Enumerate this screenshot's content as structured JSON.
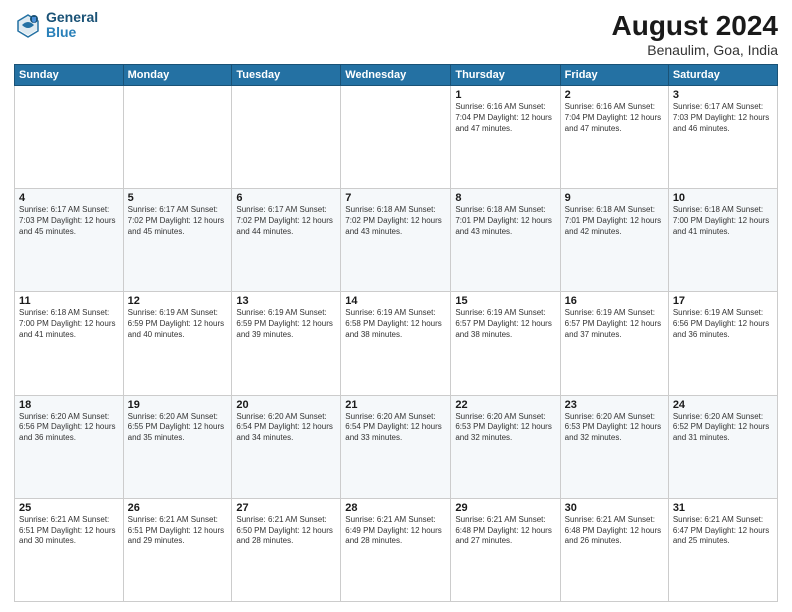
{
  "header": {
    "logo_line1": "General",
    "logo_line2": "Blue",
    "title": "August 2024",
    "subtitle": "Benaulim, Goa, India"
  },
  "weekdays": [
    "Sunday",
    "Monday",
    "Tuesday",
    "Wednesday",
    "Thursday",
    "Friday",
    "Saturday"
  ],
  "weeks": [
    [
      {
        "day": "",
        "content": ""
      },
      {
        "day": "",
        "content": ""
      },
      {
        "day": "",
        "content": ""
      },
      {
        "day": "",
        "content": ""
      },
      {
        "day": "1",
        "content": "Sunrise: 6:16 AM\nSunset: 7:04 PM\nDaylight: 12 hours\nand 47 minutes."
      },
      {
        "day": "2",
        "content": "Sunrise: 6:16 AM\nSunset: 7:04 PM\nDaylight: 12 hours\nand 47 minutes."
      },
      {
        "day": "3",
        "content": "Sunrise: 6:17 AM\nSunset: 7:03 PM\nDaylight: 12 hours\nand 46 minutes."
      }
    ],
    [
      {
        "day": "4",
        "content": "Sunrise: 6:17 AM\nSunset: 7:03 PM\nDaylight: 12 hours\nand 45 minutes."
      },
      {
        "day": "5",
        "content": "Sunrise: 6:17 AM\nSunset: 7:02 PM\nDaylight: 12 hours\nand 45 minutes."
      },
      {
        "day": "6",
        "content": "Sunrise: 6:17 AM\nSunset: 7:02 PM\nDaylight: 12 hours\nand 44 minutes."
      },
      {
        "day": "7",
        "content": "Sunrise: 6:18 AM\nSunset: 7:02 PM\nDaylight: 12 hours\nand 43 minutes."
      },
      {
        "day": "8",
        "content": "Sunrise: 6:18 AM\nSunset: 7:01 PM\nDaylight: 12 hours\nand 43 minutes."
      },
      {
        "day": "9",
        "content": "Sunrise: 6:18 AM\nSunset: 7:01 PM\nDaylight: 12 hours\nand 42 minutes."
      },
      {
        "day": "10",
        "content": "Sunrise: 6:18 AM\nSunset: 7:00 PM\nDaylight: 12 hours\nand 41 minutes."
      }
    ],
    [
      {
        "day": "11",
        "content": "Sunrise: 6:18 AM\nSunset: 7:00 PM\nDaylight: 12 hours\nand 41 minutes."
      },
      {
        "day": "12",
        "content": "Sunrise: 6:19 AM\nSunset: 6:59 PM\nDaylight: 12 hours\nand 40 minutes."
      },
      {
        "day": "13",
        "content": "Sunrise: 6:19 AM\nSunset: 6:59 PM\nDaylight: 12 hours\nand 39 minutes."
      },
      {
        "day": "14",
        "content": "Sunrise: 6:19 AM\nSunset: 6:58 PM\nDaylight: 12 hours\nand 38 minutes."
      },
      {
        "day": "15",
        "content": "Sunrise: 6:19 AM\nSunset: 6:57 PM\nDaylight: 12 hours\nand 38 minutes."
      },
      {
        "day": "16",
        "content": "Sunrise: 6:19 AM\nSunset: 6:57 PM\nDaylight: 12 hours\nand 37 minutes."
      },
      {
        "day": "17",
        "content": "Sunrise: 6:19 AM\nSunset: 6:56 PM\nDaylight: 12 hours\nand 36 minutes."
      }
    ],
    [
      {
        "day": "18",
        "content": "Sunrise: 6:20 AM\nSunset: 6:56 PM\nDaylight: 12 hours\nand 36 minutes."
      },
      {
        "day": "19",
        "content": "Sunrise: 6:20 AM\nSunset: 6:55 PM\nDaylight: 12 hours\nand 35 minutes."
      },
      {
        "day": "20",
        "content": "Sunrise: 6:20 AM\nSunset: 6:54 PM\nDaylight: 12 hours\nand 34 minutes."
      },
      {
        "day": "21",
        "content": "Sunrise: 6:20 AM\nSunset: 6:54 PM\nDaylight: 12 hours\nand 33 minutes."
      },
      {
        "day": "22",
        "content": "Sunrise: 6:20 AM\nSunset: 6:53 PM\nDaylight: 12 hours\nand 32 minutes."
      },
      {
        "day": "23",
        "content": "Sunrise: 6:20 AM\nSunset: 6:53 PM\nDaylight: 12 hours\nand 32 minutes."
      },
      {
        "day": "24",
        "content": "Sunrise: 6:20 AM\nSunset: 6:52 PM\nDaylight: 12 hours\nand 31 minutes."
      }
    ],
    [
      {
        "day": "25",
        "content": "Sunrise: 6:21 AM\nSunset: 6:51 PM\nDaylight: 12 hours\nand 30 minutes."
      },
      {
        "day": "26",
        "content": "Sunrise: 6:21 AM\nSunset: 6:51 PM\nDaylight: 12 hours\nand 29 minutes."
      },
      {
        "day": "27",
        "content": "Sunrise: 6:21 AM\nSunset: 6:50 PM\nDaylight: 12 hours\nand 28 minutes."
      },
      {
        "day": "28",
        "content": "Sunrise: 6:21 AM\nSunset: 6:49 PM\nDaylight: 12 hours\nand 28 minutes."
      },
      {
        "day": "29",
        "content": "Sunrise: 6:21 AM\nSunset: 6:48 PM\nDaylight: 12 hours\nand 27 minutes."
      },
      {
        "day": "30",
        "content": "Sunrise: 6:21 AM\nSunset: 6:48 PM\nDaylight: 12 hours\nand 26 minutes."
      },
      {
        "day": "31",
        "content": "Sunrise: 6:21 AM\nSunset: 6:47 PM\nDaylight: 12 hours\nand 25 minutes."
      }
    ]
  ]
}
